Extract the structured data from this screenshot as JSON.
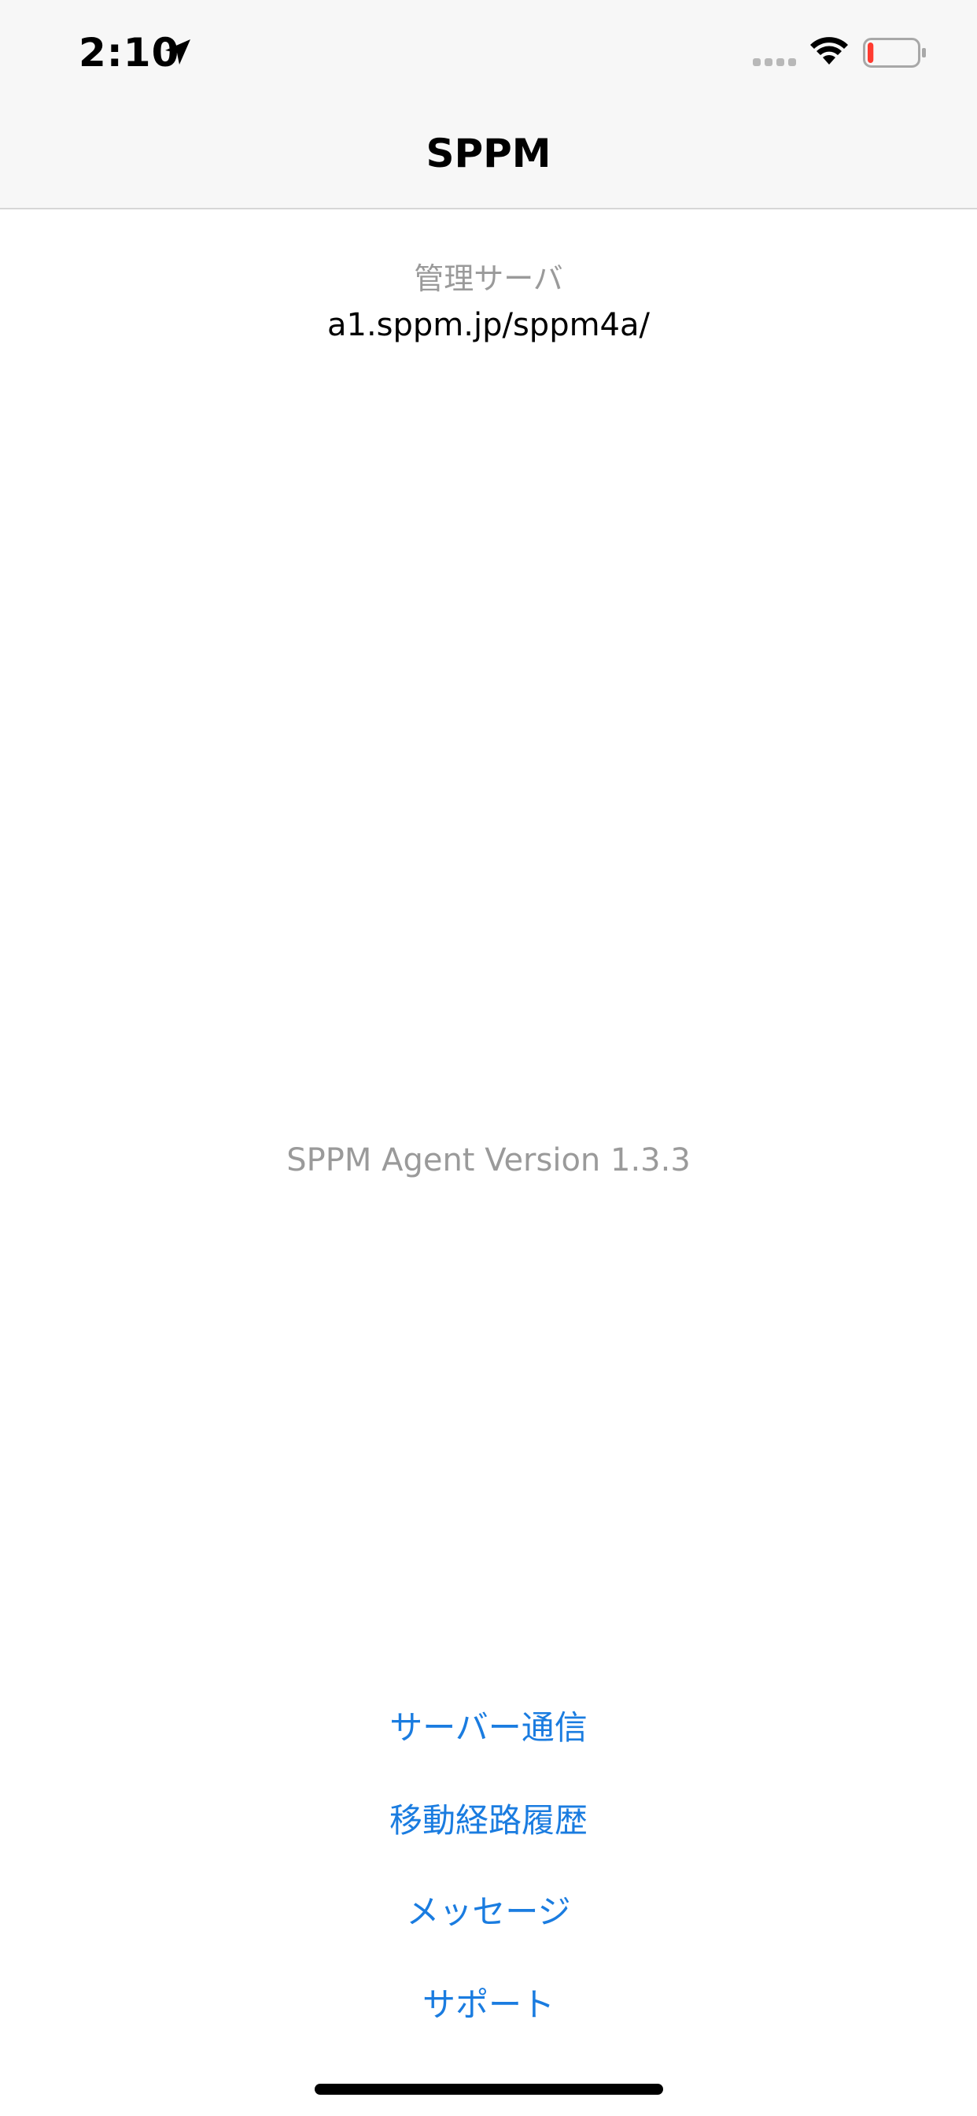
{
  "status_bar": {
    "time": "2:10",
    "icons": [
      "location-arrow-icon",
      "cellular-signal-icon",
      "wifi-icon",
      "battery-low-icon"
    ],
    "battery_level": 0.12,
    "battery_color": "#ff3b30"
  },
  "nav": {
    "title": "SPPM"
  },
  "server": {
    "label": "管理サーバ",
    "url": "a1.sppm.jp/sppm4a/"
  },
  "version": "SPPM Agent Version 1.3.3",
  "menu": {
    "items": [
      {
        "label": "サーバー通信"
      },
      {
        "label": "移動経路履歴"
      },
      {
        "label": "メッセージ"
      },
      {
        "label": "サポート"
      }
    ]
  },
  "colors": {
    "link": "#1a7ce0",
    "secondary_text": "#9a9a9a"
  }
}
